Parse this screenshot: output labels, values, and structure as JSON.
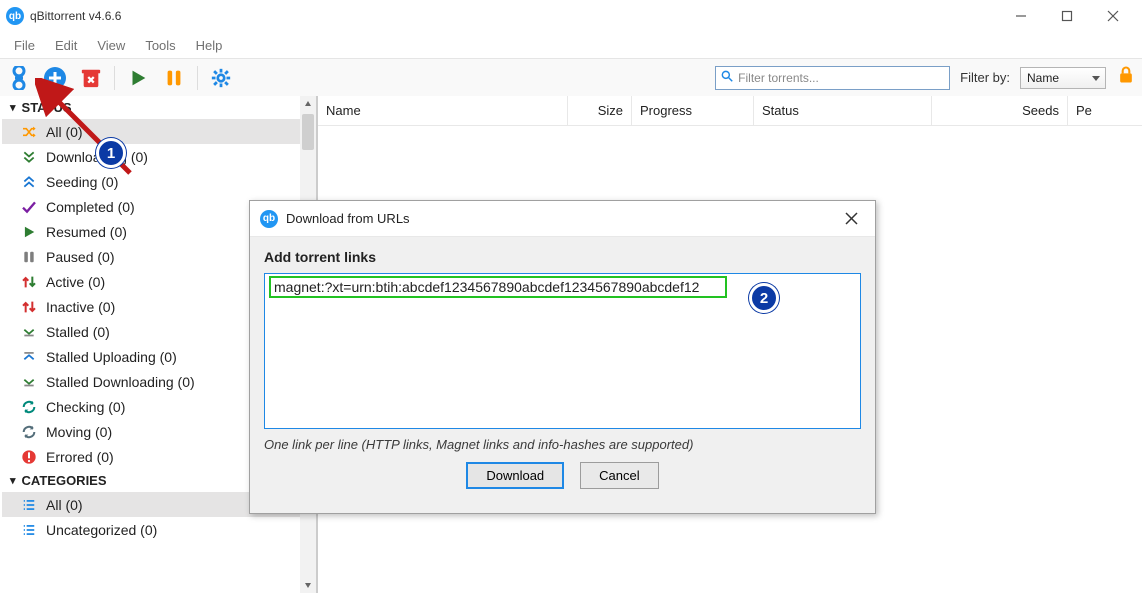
{
  "window": {
    "title": "qBittorrent v4.6.6"
  },
  "menu": {
    "items": [
      "File",
      "Edit",
      "View",
      "Tools",
      "Help"
    ]
  },
  "toolbar": {
    "filter_placeholder": "Filter torrents...",
    "filterby_label": "Filter by:",
    "filterby_value": "Name"
  },
  "sidebar": {
    "status_header": "STATUS",
    "items": [
      {
        "icon": "shuffle",
        "color": "#ff9800",
        "label": "All (0)",
        "selected": true
      },
      {
        "icon": "double-down",
        "color": "#2e7d32",
        "label": "Downloading (0)"
      },
      {
        "icon": "double-up",
        "color": "#1976d2",
        "label": "Seeding (0)"
      },
      {
        "icon": "check",
        "color": "#7b1fa2",
        "label": "Completed (0)"
      },
      {
        "icon": "play",
        "color": "#2e7d32",
        "label": "Resumed (0)"
      },
      {
        "icon": "pause",
        "color": "#7e7e7e",
        "label": "Paused (0)"
      },
      {
        "icon": "updown",
        "color": "#d32f2f",
        "label": "Active (0)"
      },
      {
        "icon": "updown",
        "color": "#d32f2f",
        "label": "Inactive (0)"
      },
      {
        "icon": "stalled-down",
        "color": "#2e7d32",
        "label": "Stalled (0)"
      },
      {
        "icon": "stalled-up",
        "color": "#1976d2",
        "label": "Stalled Uploading (0)"
      },
      {
        "icon": "stalled-down",
        "color": "#2e7d32",
        "label": "Stalled Downloading (0)"
      },
      {
        "icon": "refresh",
        "color": "#00897b",
        "label": "Checking (0)"
      },
      {
        "icon": "refresh",
        "color": "#546e7a",
        "label": "Moving (0)"
      },
      {
        "icon": "error",
        "color": "#e53935",
        "label": "Errored (0)"
      }
    ],
    "categories_header": "CATEGORIES",
    "categories": [
      {
        "label": "All (0)",
        "selected": true
      },
      {
        "label": "Uncategorized (0)"
      }
    ]
  },
  "columns": {
    "name": "Name",
    "size": "Size",
    "progress": "Progress",
    "status": "Status",
    "seeds": "Seeds",
    "pe": "Pe"
  },
  "dialog": {
    "title": "Download from URLs",
    "heading": "Add torrent links",
    "input_value": "magnet:?xt=urn:btih:abcdef1234567890abcdef1234567890abcdef12",
    "hint": "One link per line (HTTP links, Magnet links and info-hashes are supported)",
    "download": "Download",
    "cancel": "Cancel"
  },
  "annotations": {
    "badge1": "1",
    "badge2": "2"
  }
}
